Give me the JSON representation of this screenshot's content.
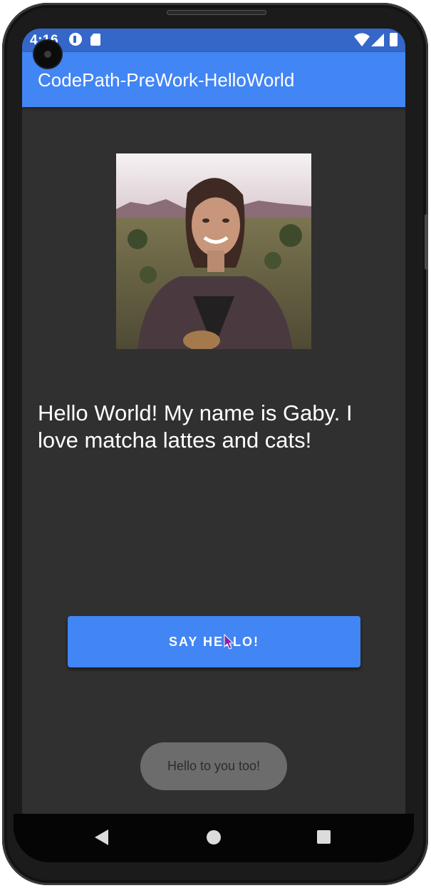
{
  "status_bar": {
    "time": "4:16",
    "icons": [
      "notification-app-icon",
      "sd-card-icon",
      "wifi-icon",
      "signal-icon",
      "battery-icon"
    ]
  },
  "app_bar": {
    "title": "CodePath-PreWork-HelloWorld",
    "color": "#4285f4",
    "status_color": "#3567c9"
  },
  "profile": {
    "image": "profile-photo"
  },
  "greeting": {
    "text": "Hello World! My name is Gaby. I love matcha lattes and cats!"
  },
  "button": {
    "label": "SAY HELLO!",
    "color": "#4285f4"
  },
  "toast": {
    "message": "Hello to you too!"
  },
  "nav_bar": {
    "icons": [
      "back-icon",
      "home-icon",
      "recents-icon"
    ]
  },
  "theme": {
    "background": "#303030"
  }
}
